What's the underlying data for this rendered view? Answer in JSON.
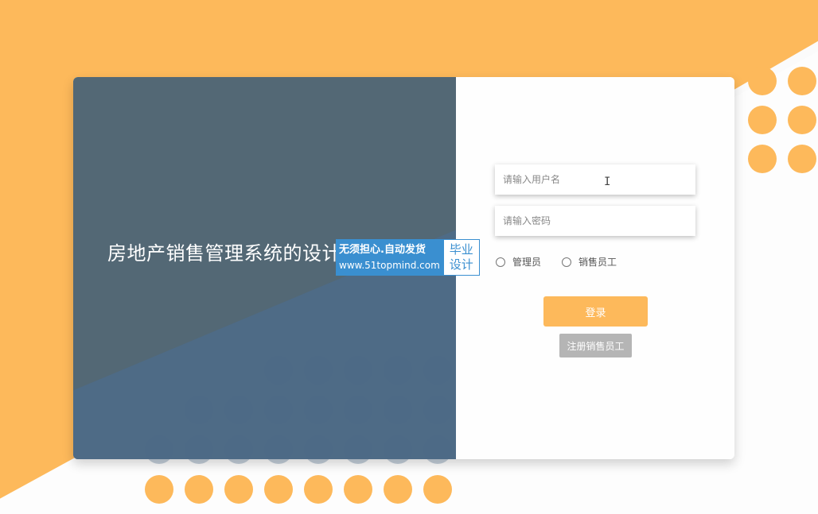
{
  "system": {
    "title": "房地产销售管理系统的设计登录"
  },
  "login": {
    "username_placeholder": "请输入用户名",
    "password_placeholder": "请输入密码",
    "roles": [
      "管理员",
      "销售员工"
    ],
    "login_label": "登录",
    "register_label": "注册销售员工"
  },
  "watermark": {
    "line1": "无须担心.自动发货",
    "line2": "www.51topmind.com",
    "badge1": "毕业",
    "badge2": "设计"
  },
  "colors": {
    "accent": "#FDB95B",
    "panel": "#536875",
    "panel_blue": "#4e6b86",
    "register_button": "#b5b5b5",
    "watermark_blue": "#3a8fd0"
  }
}
